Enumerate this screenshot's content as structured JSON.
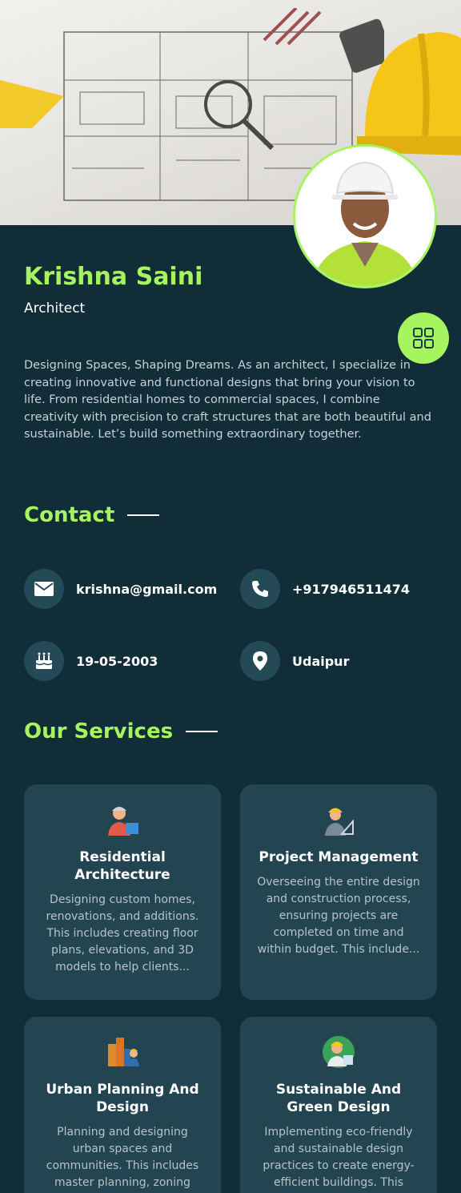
{
  "profile": {
    "name": "Krishna Saini",
    "role": "Architect",
    "bio": "Designing Spaces, Shaping Dreams. As an architect, I specialize in creating innovative and functional designs that bring your vision to life. From residential homes to commercial spaces, I combine creativity with precision to craft structures that are both beautiful and sustainable. Let’s build something extraordinary together."
  },
  "contact": {
    "title": "Contact",
    "email": "krishna@gmail.com",
    "phone": "+917946511474",
    "birthday": "19-05-2003",
    "location": "Udaipur"
  },
  "services": {
    "title": "Our Services",
    "items": [
      {
        "icon": "architect-icon",
        "title": "Residential Architecture",
        "desc": "Designing custom homes, renovations, and additions. This includes creating floor plans, elevations, and 3D models to help clients..."
      },
      {
        "icon": "engineer-icon",
        "title": "Project Management",
        "desc": "Overseeing the entire design and construction process, ensuring projects are completed on time and within budget. This include..."
      },
      {
        "icon": "city-planner-icon",
        "title": "Urban Planning And Design",
        "desc": "Planning and designing urban spaces and communities. This includes master planning, zoning"
      },
      {
        "icon": "eco-worker-icon",
        "title": "Sustainable And Green Design",
        "desc": "Implementing eco-friendly and sustainable design practices to create energy-efficient buildings. This"
      }
    ]
  },
  "colors": {
    "background": "#112d38",
    "accent": "#a6f45f",
    "card": "#234552"
  }
}
